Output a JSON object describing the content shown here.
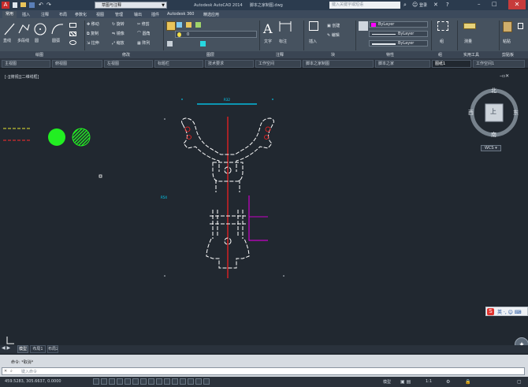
{
  "title_bar": {
    "workspace": "草图与注释",
    "app_title": "Autodesk AutoCAD 2014",
    "file_name": "脚本之家制图.dwg",
    "search_placeholder": "键入关键字或短语",
    "user": "登录"
  },
  "menu": [
    "常用",
    "插入",
    "注释",
    "布局",
    "参数化",
    "视图",
    "管理",
    "输出",
    "插件",
    "Autodesk 360",
    "精选应用"
  ],
  "ribbon": {
    "draw_tools": [
      "直线",
      "多段线",
      "圆",
      "圆弧"
    ],
    "modify_tools": [
      "移动",
      "旋转",
      "修剪",
      "复制",
      "镜像",
      "圆角",
      "拉伸",
      "缩放",
      "阵列"
    ],
    "layer_current": "0",
    "text_tool": "文字",
    "dimension_tool": "标注",
    "block_insert": "插入",
    "block_create": "创建",
    "block_edit": "编辑",
    "color_value": "ByLayer",
    "linetype_value": "ByLayer",
    "lineweight_value": "ByLayer",
    "group_tool": "组",
    "utilities_tool": "测量",
    "paste_tool": "粘贴",
    "panel_titles": [
      "绘图",
      "修改",
      "图层",
      "注释",
      "块",
      "特性",
      "组",
      "实用工具",
      "剪贴板"
    ]
  },
  "file_tabs": [
    "主视图",
    "俯视图",
    "左视图",
    "标题栏",
    "技术要求",
    "工作空间",
    "脚本之家制图",
    "脚本之家",
    "图纸1",
    "工作空间1"
  ],
  "viewport_label": "[-][俯视][二维线框]",
  "viewcube": {
    "top": "上",
    "north": "北",
    "south": "南",
    "east": "东",
    "west": "西",
    "wcs": "WCS"
  },
  "drawing": {
    "dim_text": "R32",
    "dim_label_left": "R54"
  },
  "layout_tabs": [
    "模型",
    "布局1",
    "布局2"
  ],
  "command": {
    "history": "命令: *取消*",
    "prompt": "键入命令"
  },
  "status": {
    "coordinates": "459.5283, 305.6637, 0.0000",
    "mode": "模型",
    "scale": "1:1"
  },
  "colors": {
    "accent": "#2b3b4e",
    "canvas": "#212830",
    "drawing": "#ffffff",
    "axis": "#ff2020",
    "dimension": "#00d7ff",
    "fill_green": "#22ee22",
    "magenta": "#c800c8"
  }
}
